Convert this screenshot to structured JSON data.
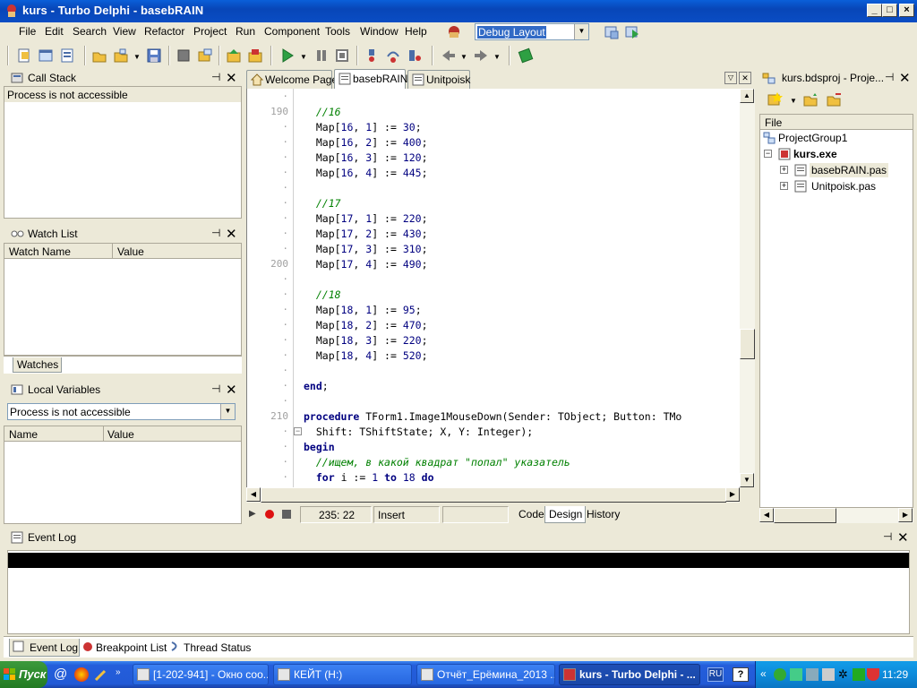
{
  "window": {
    "title": "kurs - Turbo Delphi - basebRAIN"
  },
  "menu": {
    "items": [
      "File",
      "Edit",
      "Search",
      "View",
      "Refactor",
      "Project",
      "Run",
      "Component",
      "Tools",
      "Window",
      "Help"
    ],
    "layout_combo": "Debug Layout"
  },
  "call_stack": {
    "title": "Call Stack",
    "status": "Process is not accessible"
  },
  "watch_list": {
    "title": "Watch List",
    "col_name": "Watch Name",
    "col_value": "Value",
    "tab": "Watches"
  },
  "local_vars": {
    "title": "Local Variables",
    "combo": "Process is not accessible",
    "col_name": "Name",
    "col_value": "Value"
  },
  "editor_tabs": [
    "Welcome Page",
    "basebRAIN",
    "Unitpoisk"
  ],
  "editor": {
    "lines": [
      {
        "n": "190",
        "t": "  //16"
      },
      {
        "n": "",
        "t": "  Map[16, 1] := 30;"
      },
      {
        "n": "",
        "t": "  Map[16, 2] := 400;"
      },
      {
        "n": "",
        "t": "  Map[16, 3] := 120;"
      },
      {
        "n": "",
        "t": "  Map[16, 4] := 445;"
      },
      {
        "n": "",
        "t": ""
      },
      {
        "n": "",
        "t": "  //17"
      },
      {
        "n": "",
        "t": "  Map[17, 1] := 220;"
      },
      {
        "n": "",
        "t": "  Map[17, 2] := 430;"
      },
      {
        "n": "",
        "t": "  Map[17, 3] := 310;"
      },
      {
        "n": "200",
        "t": "  Map[17, 4] := 490;"
      },
      {
        "n": "",
        "t": ""
      },
      {
        "n": "",
        "t": "  //18"
      },
      {
        "n": "",
        "t": "  Map[18, 1] := 95;"
      },
      {
        "n": "",
        "t": "  Map[18, 2] := 470;"
      },
      {
        "n": "",
        "t": "  Map[18, 3] := 220;"
      },
      {
        "n": "",
        "t": "  Map[18, 4] := 520;"
      },
      {
        "n": "",
        "t": ""
      },
      {
        "n": "",
        "t": "end;"
      },
      {
        "n": "",
        "t": ""
      },
      {
        "n": "210",
        "t": "procedure TForm1.Image1MouseDown(Sender: TObject; Button: TMo"
      },
      {
        "n": "",
        "t": "  Shift: TShiftState; X, Y: Integer);"
      },
      {
        "n": "",
        "t": "begin"
      },
      {
        "n": "",
        "t": "  //ищем, в какой квадрат \"попал\" указатель"
      },
      {
        "n": "",
        "t": "  for i := 1 to 18 do"
      }
    ]
  },
  "status": {
    "position": "235: 22",
    "mode": "Insert",
    "tabs": [
      "Code",
      "Design",
      "History"
    ]
  },
  "project": {
    "title": "kurs.bdsproj - Proje...",
    "col": "File",
    "group": "ProjectGroup1",
    "exe": "kurs.exe",
    "files": [
      "basebRAIN.pas",
      "Unitpoisk.pas"
    ]
  },
  "event_log": {
    "title": "Event Log"
  },
  "bottom_tabs": [
    "Event Log",
    "Breakpoint List",
    "Thread Status"
  ],
  "taskbar": {
    "start": "Пуск",
    "tasks": [
      "[1-202-941] - Окно соо...",
      "КЕЙТ (H:)",
      "Отчёт_Ерёмина_2013 ...",
      "kurs - Turbo Delphi - ..."
    ],
    "lang": "RU",
    "clock": "11:29"
  }
}
